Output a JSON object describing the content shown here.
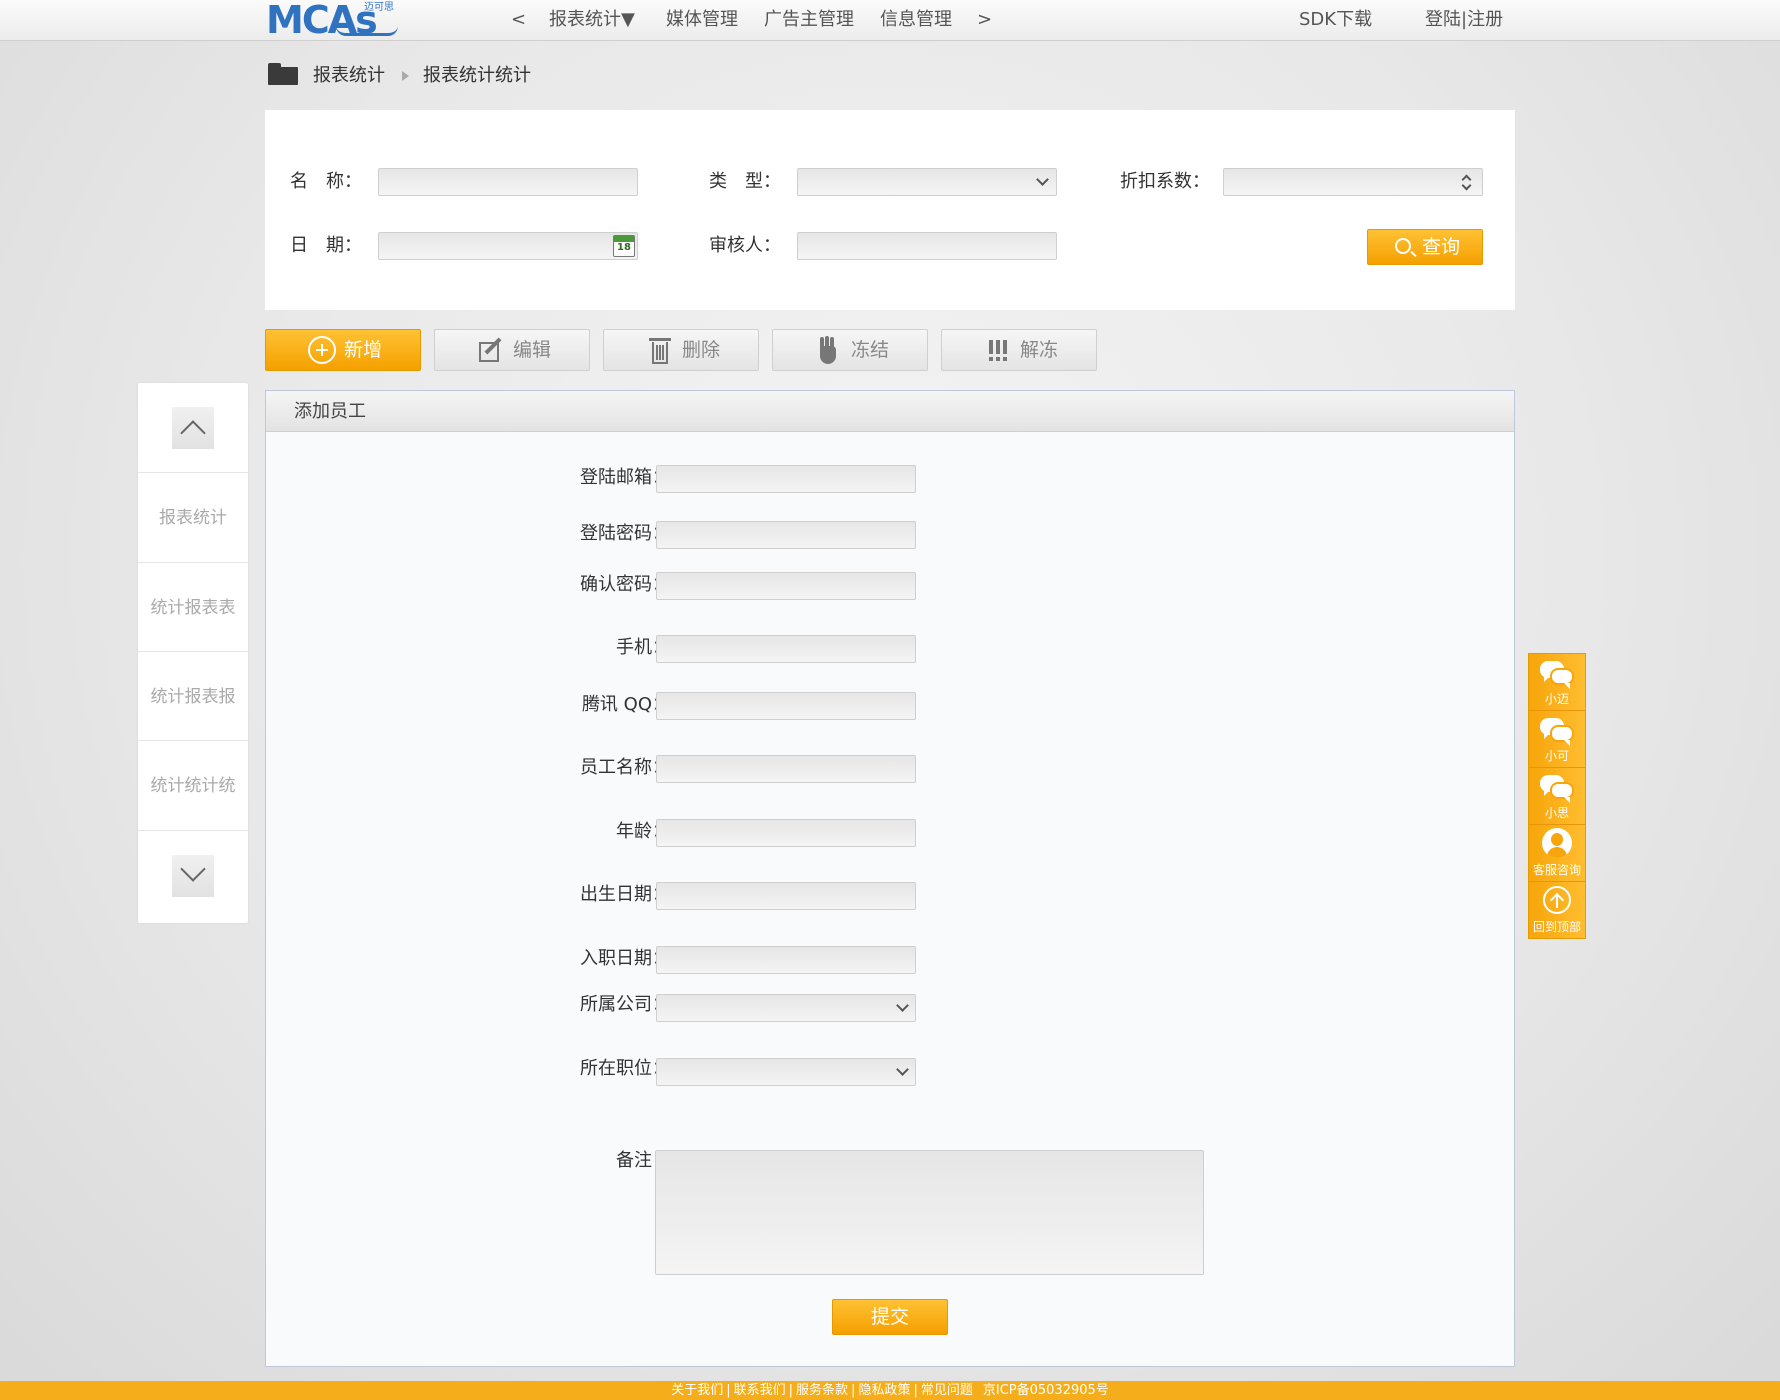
{
  "brand": {
    "logo_text": "MCAs",
    "logo_sub": "迈可思"
  },
  "nav": {
    "prev": "<",
    "next": ">",
    "items": [
      {
        "label": "报表统计▼"
      },
      {
        "label": "媒体管理"
      },
      {
        "label": "广告主管理"
      },
      {
        "label": "信息管理"
      }
    ],
    "sdk": "SDK下载",
    "login": "登陆",
    "separator": "|",
    "register": "注册"
  },
  "breadcrumb": {
    "items": [
      "报表统计",
      "报表统计统计"
    ]
  },
  "search": {
    "name_label": "名　称：",
    "name_value": "",
    "type_label": "类　型：",
    "type_value": "",
    "discount_label": "折扣系数：",
    "discount_value": "",
    "date_label": "日　期：",
    "date_value": "",
    "calendar_day": "18",
    "reviewer_label": "审核人：",
    "reviewer_value": "",
    "query_button": "查询"
  },
  "toolbar": {
    "add": "新增",
    "edit": "编辑",
    "delete": "删除",
    "freeze": "冻结",
    "unfreeze": "解冻"
  },
  "sidebar": {
    "items": [
      "报表统计",
      "统计报表表",
      "统计报表报",
      "统计统计统"
    ]
  },
  "form": {
    "title": "添加员工",
    "fields": [
      {
        "label": "登陆邮箱：",
        "value": ""
      },
      {
        "label": "登陆密码：",
        "value": ""
      },
      {
        "label": "确认密码：",
        "value": ""
      },
      {
        "label": "手机：",
        "value": ""
      },
      {
        "label": "腾讯 QQ：",
        "value": ""
      },
      {
        "label": "员工名称：",
        "value": ""
      },
      {
        "label": "年龄：",
        "value": ""
      },
      {
        "label": "出生日期：",
        "value": ""
      },
      {
        "label": "入职日期：",
        "value": ""
      },
      {
        "label": "所属公司：",
        "value": ""
      },
      {
        "label": "所在职位：",
        "value": ""
      },
      {
        "label": "备注：",
        "value": ""
      }
    ],
    "submit": "提交"
  },
  "float_bar": {
    "items": [
      "小迈",
      "小可",
      "小思",
      "客服咨询",
      "回到顶部"
    ]
  },
  "footer": {
    "links": [
      "关于我们",
      "联系我们",
      "服务条款",
      "隐私政策",
      "常见问题"
    ],
    "separator": "|",
    "icp": "京ICP备05032905号"
  },
  "colors": {
    "accent_orange": "#f7a50a",
    "brand_blue": "#2f73c0",
    "panel_border": "#bfc8d8"
  },
  "icons": [
    "folder-icon",
    "calendar-icon",
    "search-icon",
    "plus-circle-icon",
    "edit-icon",
    "trash-icon",
    "hand-icon",
    "exclamation-icon",
    "chevron-up-icon",
    "chevron-down-icon",
    "chat-icon",
    "person-icon",
    "arrow-up-circle-icon"
  ]
}
